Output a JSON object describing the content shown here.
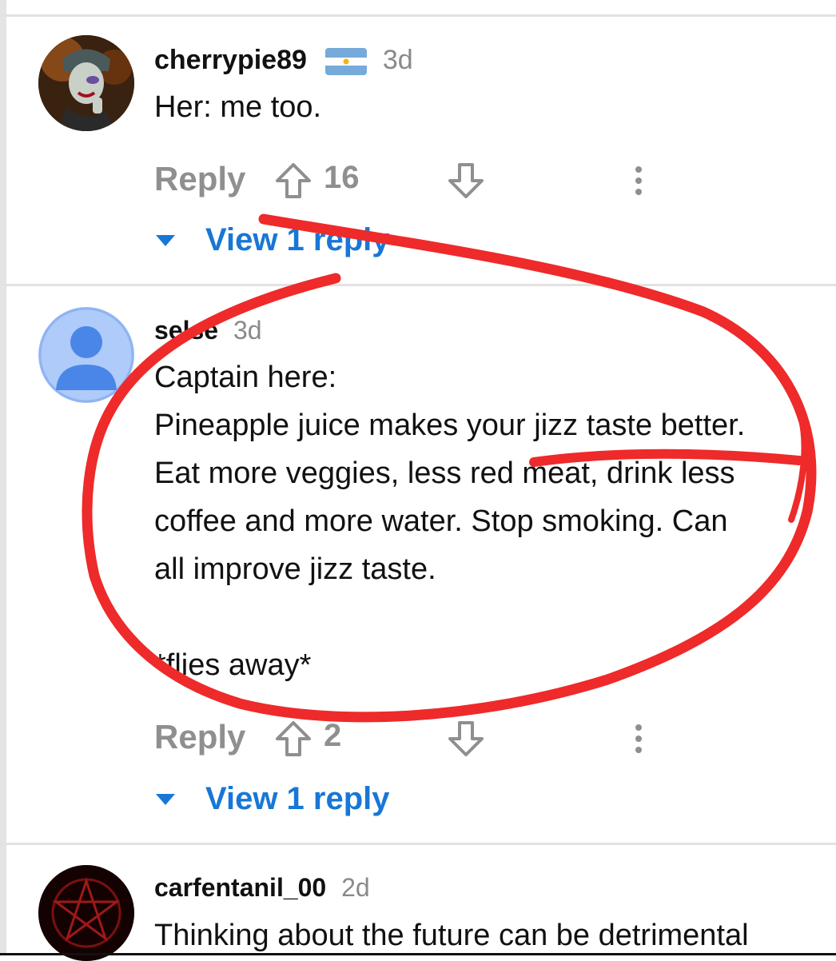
{
  "comments": [
    {
      "username": "cherrypie89",
      "flag": "argentina-flag",
      "time": "3d",
      "text": "Her: me too.",
      "reply_label": "Reply",
      "score": "16",
      "view_replies": "View 1 reply"
    },
    {
      "username": "selse",
      "time": "3d",
      "text": "Captain here:\nPineapple juice makes your jizz taste better.\nEat more veggies, less red meat, drink less\ncoffee and more water. Stop smoking. Can\nall improve jizz taste.\n\n*flies away*",
      "reply_label": "Reply",
      "score": "2",
      "view_replies": "View 1 reply"
    },
    {
      "username": "carfentanil_00",
      "time": "2d",
      "text": "Thinking about the future can be detrimental"
    }
  ],
  "colors": {
    "link_blue": "#1877d6",
    "muted_gray": "#8f8f8f",
    "annotation_red": "#ee2a2a",
    "default_avatar_bg": "#aecbfa",
    "default_avatar_fg": "#4285f4"
  }
}
